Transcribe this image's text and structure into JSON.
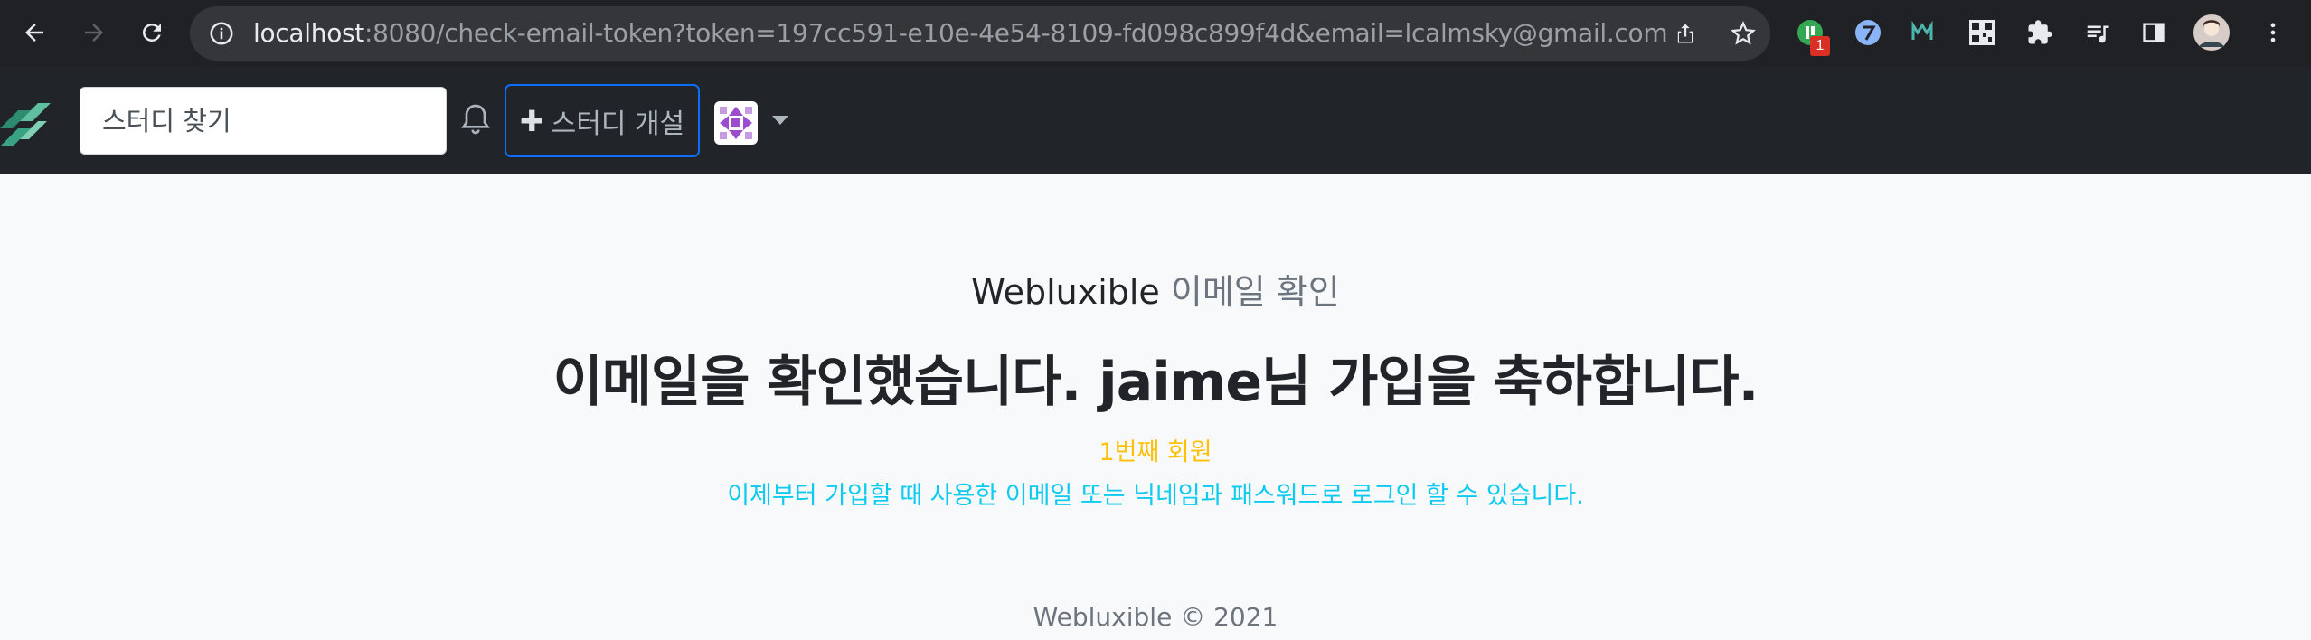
{
  "browser": {
    "url_host": "localhost",
    "url_rest": ":8080/check-email-token?token=197cc591-e10e-4e54-8109-fd098c899f4d&email=lcalmsky@gmail.com",
    "extension_badge": "1"
  },
  "navbar": {
    "search_placeholder": "스터디 찾기",
    "new_study_label": "스터디 개설",
    "new_study_plus": "✚"
  },
  "main": {
    "subtitle_brand": "Webluxible",
    "subtitle_text": " 이메일 확인",
    "headline": "이메일을 확인했습니다. jaime님 가입을 축하합니다.",
    "member_count": "1번째 회원",
    "info": "이제부터 가입할 때 사용한 이메일 또는 닉네임과 패스워드로 로그인 할 수 있습니다."
  },
  "footer": {
    "text": "Webluxible © 2021"
  },
  "colors": {
    "chrome_bg": "#202124",
    "navbar_bg": "#212529",
    "page_bg": "#f8f9fa",
    "member_color": "#ffc107",
    "info_color": "#0dcaf0",
    "primary": "#0d6efd"
  }
}
